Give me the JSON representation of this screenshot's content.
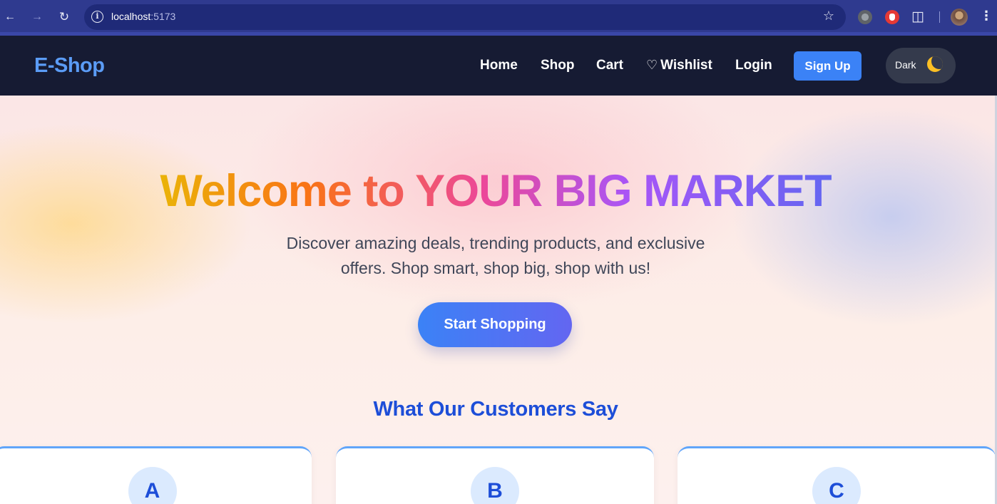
{
  "browser": {
    "url_host": "localhost",
    "url_port": ":5173",
    "icons": [
      "back-arrow-icon",
      "forward-arrow-icon",
      "reload-icon",
      "info-icon",
      "star-icon",
      "extension-icon",
      "puzzle-icon",
      "profile-avatar",
      "menu-icon"
    ]
  },
  "navbar": {
    "brand": "E-Shop",
    "links": [
      "Home",
      "Shop",
      "Cart",
      "Wishlist",
      "Login"
    ],
    "signup": "Sign Up",
    "theme_label": "Dark"
  },
  "hero": {
    "headline": "Welcome to YOUR BIG MARKET",
    "subtitle_line1": "Discover amazing deals, trending products, and exclusive",
    "subtitle_line2": "offers. Shop smart, shop big, shop with us!",
    "cta": "Start Shopping"
  },
  "testimonials": {
    "title": "What Our Customers Say",
    "initials": [
      "A",
      "B",
      "C"
    ]
  },
  "colors": {
    "brand": "#5b9cf6",
    "navbar_bg": "#161b33",
    "primary": "#3b82f6",
    "accent_title": "#1d4ed8",
    "moon": "#fbbf24"
  }
}
